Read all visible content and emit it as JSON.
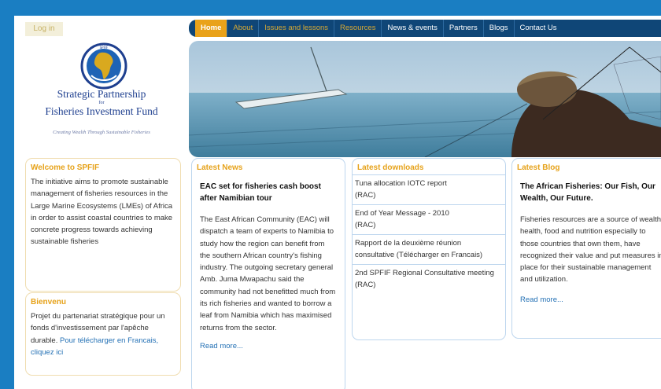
{
  "login": "Log in",
  "logo": {
    "title_line1": "Strategic Partnership",
    "title_for": "for",
    "title_line2": "Fisheries Investment Fund",
    "tagline": "Creating Wealth Through Sustainable Fisheries",
    "icon": "africa-globe-logo-icon"
  },
  "nav": {
    "items": [
      "Home",
      "About",
      "Issues and lessons",
      "Resources",
      "News & events",
      "Partners",
      "Blogs",
      "Contact Us"
    ]
  },
  "hero": {
    "icon": "fisherman-photo"
  },
  "welcome": {
    "title": "Welcome to SPFIF",
    "text": "The initiative aims to promote sustainable management of fisheries resources in the Large Marine Ecosystems (LMEs) of Africa in order to assist coastal countries to make concrete progress towards achieving sustainable fisheries"
  },
  "bienvenu": {
    "title": "Bienvenu",
    "text": "Projet du partenariat stratégique pour un fonds d'investissement par l'apêche durable.",
    "link": "Pour télécharger en Francais, cliquez ici"
  },
  "news": {
    "title": "Latest News",
    "headline": "EAC set for fisheries cash boost after Namibian tour",
    "body": "The East African Community (EAC) will dispatch a team of experts to Namibia to study how the region can benefit from the southern African country's fishing industry. The outgoing secretary general Amb. Juma Mwapachu said the community had not benefitted much from its rich fisheries and wanted to borrow a leaf from Namibia which has maximised returns from the sector.",
    "read_more": "Read more..."
  },
  "downloads": {
    "title": "Latest downloads",
    "items": [
      {
        "name": "Tuna allocation IOTC report",
        "tag": "(RAC)"
      },
      {
        "name": "End of Year Message - 2010",
        "tag": "(RAC)"
      },
      {
        "name": "Rapport de la deuxième réunion consultative (Télécharger en Francais)",
        "tag": ""
      },
      {
        "name": "2nd SPFIF Regional Consultative meeting",
        "tag": "(RAC)"
      }
    ]
  },
  "blog": {
    "title": "Latest Blog",
    "headline": "The African Fisheries: Our Fish, Our Wealth, Our Future.",
    "body": "Fisheries resources are a source of wealth, health, food and nutrition especially to those countries that own them, have recognized their value and put measures in place for their sustainable management and utilization.",
    "read_more": "Read more..."
  },
  "colors": {
    "frame_blue": "#1a7ec2",
    "nav_dark": "#0f4677",
    "accent_orange": "#e6a21a",
    "link_blue": "#2471b5"
  }
}
